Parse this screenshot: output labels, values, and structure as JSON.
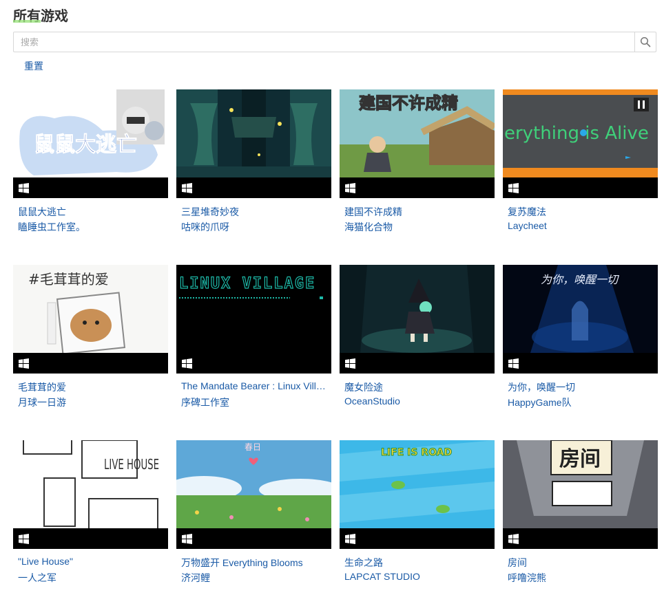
{
  "header": {
    "title": "所有游戏"
  },
  "search": {
    "placeholder": "搜索",
    "value": "",
    "icon": "search-icon"
  },
  "reset_label": "重置",
  "platform_icon": "windows-icon",
  "games": [
    {
      "name": "鼠鼠大逃亡",
      "author": "瞌睡虫工作室。",
      "thumb_text": "鼠鼠大逃亡"
    },
    {
      "name": "三星堆奇妙夜",
      "author": "咕咪的爪呀",
      "thumb_text": ""
    },
    {
      "name": "建国不许成精",
      "author": "海猫化合物",
      "thumb_text": "建国不许成精"
    },
    {
      "name": "复苏魔法",
      "author": "Laycheet",
      "thumb_text": "erything is Alive"
    },
    {
      "name": "毛茸茸的爱",
      "author": "月球一日游",
      "thumb_text": "#毛茸茸的爱"
    },
    {
      "name": "The Mandate Bearer : Linux Village",
      "author": "序碑工作室",
      "thumb_text": "LINUX VILLAGE"
    },
    {
      "name": "魔女险途",
      "author": "OceanStudio",
      "thumb_text": ""
    },
    {
      "name": "为你，唤醒一切",
      "author": "HappyGame队",
      "thumb_text": "为你，唤醒一切"
    },
    {
      "name": "\"Live House\"",
      "author": "一人之军",
      "thumb_text": "LIVE HOUSE"
    },
    {
      "name": "万物盛开 Everything Blooms",
      "author": "济河鲤",
      "thumb_text": "春日"
    },
    {
      "name": "生命之路",
      "author": "LAPCAT STUDIO",
      "thumb_text": "LIFE IS ROAD"
    },
    {
      "name": "房间",
      "author": "呼噜浣熊",
      "thumb_text": "房间"
    }
  ]
}
